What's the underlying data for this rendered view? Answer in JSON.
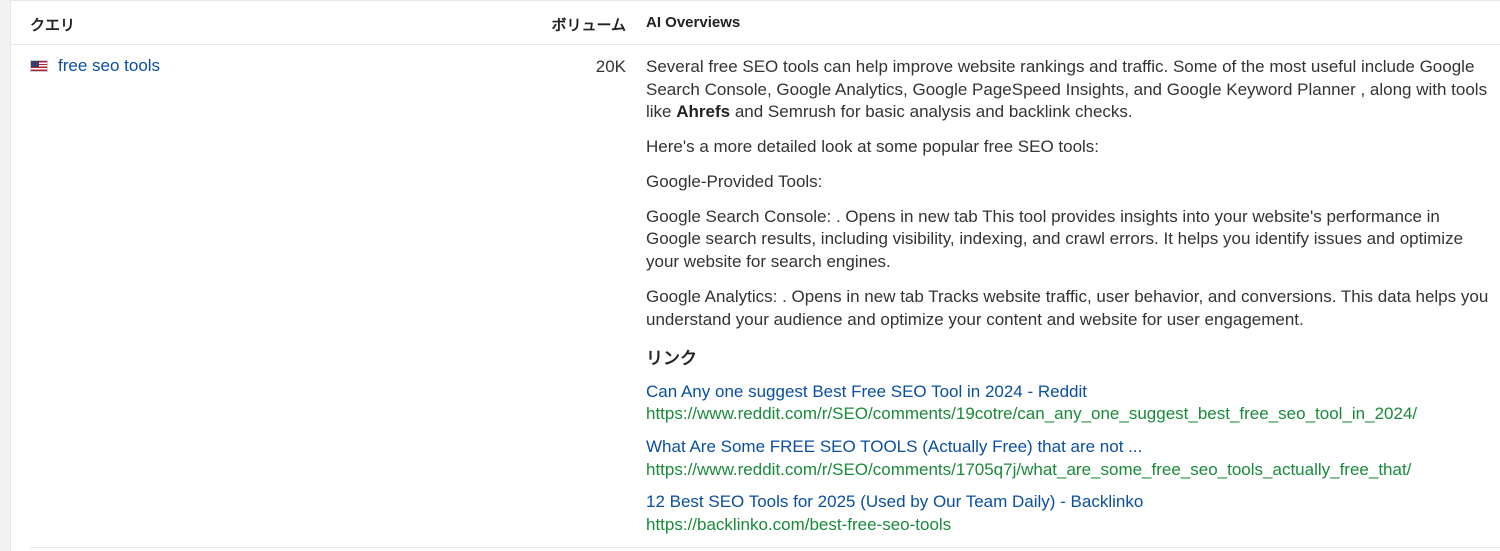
{
  "table": {
    "headers": {
      "query": "クエリ",
      "volume": "ボリューム",
      "ai_overviews": "AI Overviews"
    },
    "rows": [
      {
        "flag_icon": "us-flag-icon",
        "query": "free seo tools",
        "volume": "20K",
        "ai": {
          "intro": {
            "before": "Several free SEO tools can help improve website rankings and traffic. Some of the most useful include Google Search Console, Google Analytics, Google PageSpeed Insights, and Google Keyword Planner , along with tools like ",
            "bold": "Ahrefs",
            "after": " and Semrush for basic analysis and backlink checks."
          },
          "paragraphs": [
            "Here's a more detailed look at some popular free SEO tools:",
            "Google-Provided Tools:",
            "Google Search Console: . Opens in new tab This tool provides insights into your website's performance in Google search results, including visibility, indexing, and crawl errors. It helps you identify issues and optimize your website for search engines.",
            "Google Analytics: . Opens in new tab Tracks website traffic, user behavior, and conversions. This data helps you understand your audience and optimize your content and website for user engagement."
          ],
          "links_heading": "リンク",
          "links": [
            {
              "title": "Can Any one suggest Best Free SEO Tool in 2024 - Reddit",
              "url": "https://www.reddit.com/r/SEO/comments/19cotre/can_any_one_suggest_best_free_seo_tool_in_2024/"
            },
            {
              "title": "What Are Some FREE SEO TOOLS (Actually Free) that are not ...",
              "url": "https://www.reddit.com/r/SEO/comments/1705q7j/what_are_some_free_seo_tools_actually_free_that/"
            },
            {
              "title": "12 Best SEO Tools for 2025 (Used by Our Team Daily) - Backlinko",
              "url": "https://backlinko.com/best-free-seo-tools"
            }
          ]
        }
      }
    ]
  },
  "colors": {
    "link_blue": "#0a4fa0",
    "url_green": "#1a8a3a",
    "text": "#333333"
  }
}
